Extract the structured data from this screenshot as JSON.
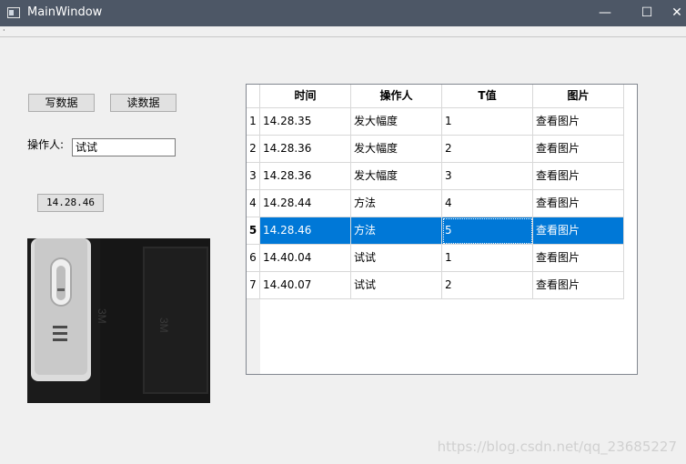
{
  "window": {
    "title": "MainWindow",
    "minimize_glyph": "—",
    "maximize_glyph": "☐",
    "close_glyph": "✕"
  },
  "menubar": {
    "marker": "·"
  },
  "buttons": {
    "write": "写数据",
    "read": "读数据",
    "time": "14.28.46"
  },
  "operator": {
    "label": "操作人:",
    "value": "试试"
  },
  "table": {
    "columns": [
      "时间",
      "操作人",
      "T值",
      "图片"
    ],
    "rows": [
      {
        "num": "1",
        "time": "14.28.35",
        "operator": "发大幅度",
        "t": "1",
        "image": "查看图片"
      },
      {
        "num": "2",
        "time": "14.28.36",
        "operator": "发大幅度",
        "t": "2",
        "image": "查看图片"
      },
      {
        "num": "3",
        "time": "14.28.36",
        "operator": "发大幅度",
        "t": "3",
        "image": "查看图片"
      },
      {
        "num": "4",
        "time": "14.28.44",
        "operator": "方法",
        "t": "4",
        "image": "查看图片"
      },
      {
        "num": "5",
        "time": "14.28.46",
        "operator": "方法",
        "t": "5",
        "image": "查看图片"
      },
      {
        "num": "6",
        "time": "14.40.04",
        "operator": "试试",
        "t": "1",
        "image": "查看图片"
      },
      {
        "num": "7",
        "time": "14.40.07",
        "operator": "试试",
        "t": "2",
        "image": "查看图片"
      }
    ],
    "selected_row": 5
  },
  "watermark": "https://blog.csdn.net/qq_23685227",
  "colors": {
    "titlebar": "#4d5766",
    "selection": "#0078d7",
    "window_bg": "#f0f0f0"
  }
}
